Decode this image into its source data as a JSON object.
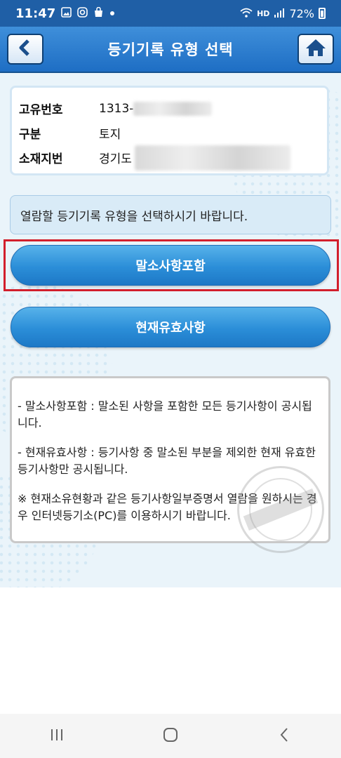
{
  "status_bar": {
    "time": "11:47",
    "notification_icons": [
      "image-icon",
      "instagram-icon",
      "shopping-bag-icon",
      "dot-icon"
    ],
    "network_label": "HD",
    "battery": "72%"
  },
  "header": {
    "title": "등기기록 유형 선택",
    "back_icon": "back-arrow-icon",
    "home_icon": "home-icon"
  },
  "info": {
    "rows": [
      {
        "label": "고유번호",
        "value": "1313-"
      },
      {
        "label": "구분",
        "value": "토지"
      },
      {
        "label": "소재지번",
        "value": "경기도"
      }
    ]
  },
  "notice": "열람할 등기기록 유형을 선택하시기 바랍니다.",
  "buttons": {
    "include_cancelled": "말소사항포함",
    "current_valid": "현재유효사항"
  },
  "description": {
    "items": [
      "- 말소사항포함 : 말소된 사항을 포함한 모든 등기사항이 공시됩니다.",
      "- 현재유효사항 : 등기사항 중 말소된 부분을 제외한 현재 유효한 등기사항만 공시됩니다.",
      "※ 현재소유현황과 같은 등기사항일부증명서 열람을 원하시는 경우 인터넷등기소(PC)를 이용하시기 바랍니다."
    ]
  },
  "nav": {
    "recent_icon": "recent-apps-icon",
    "home_icon": "home-circle-icon",
    "back_icon": "back-chevron-icon"
  },
  "colors": {
    "header": "#1e6ec4",
    "button": "#2b8ed8",
    "highlight": "#d21f2c",
    "background": "#eaf4fa"
  }
}
